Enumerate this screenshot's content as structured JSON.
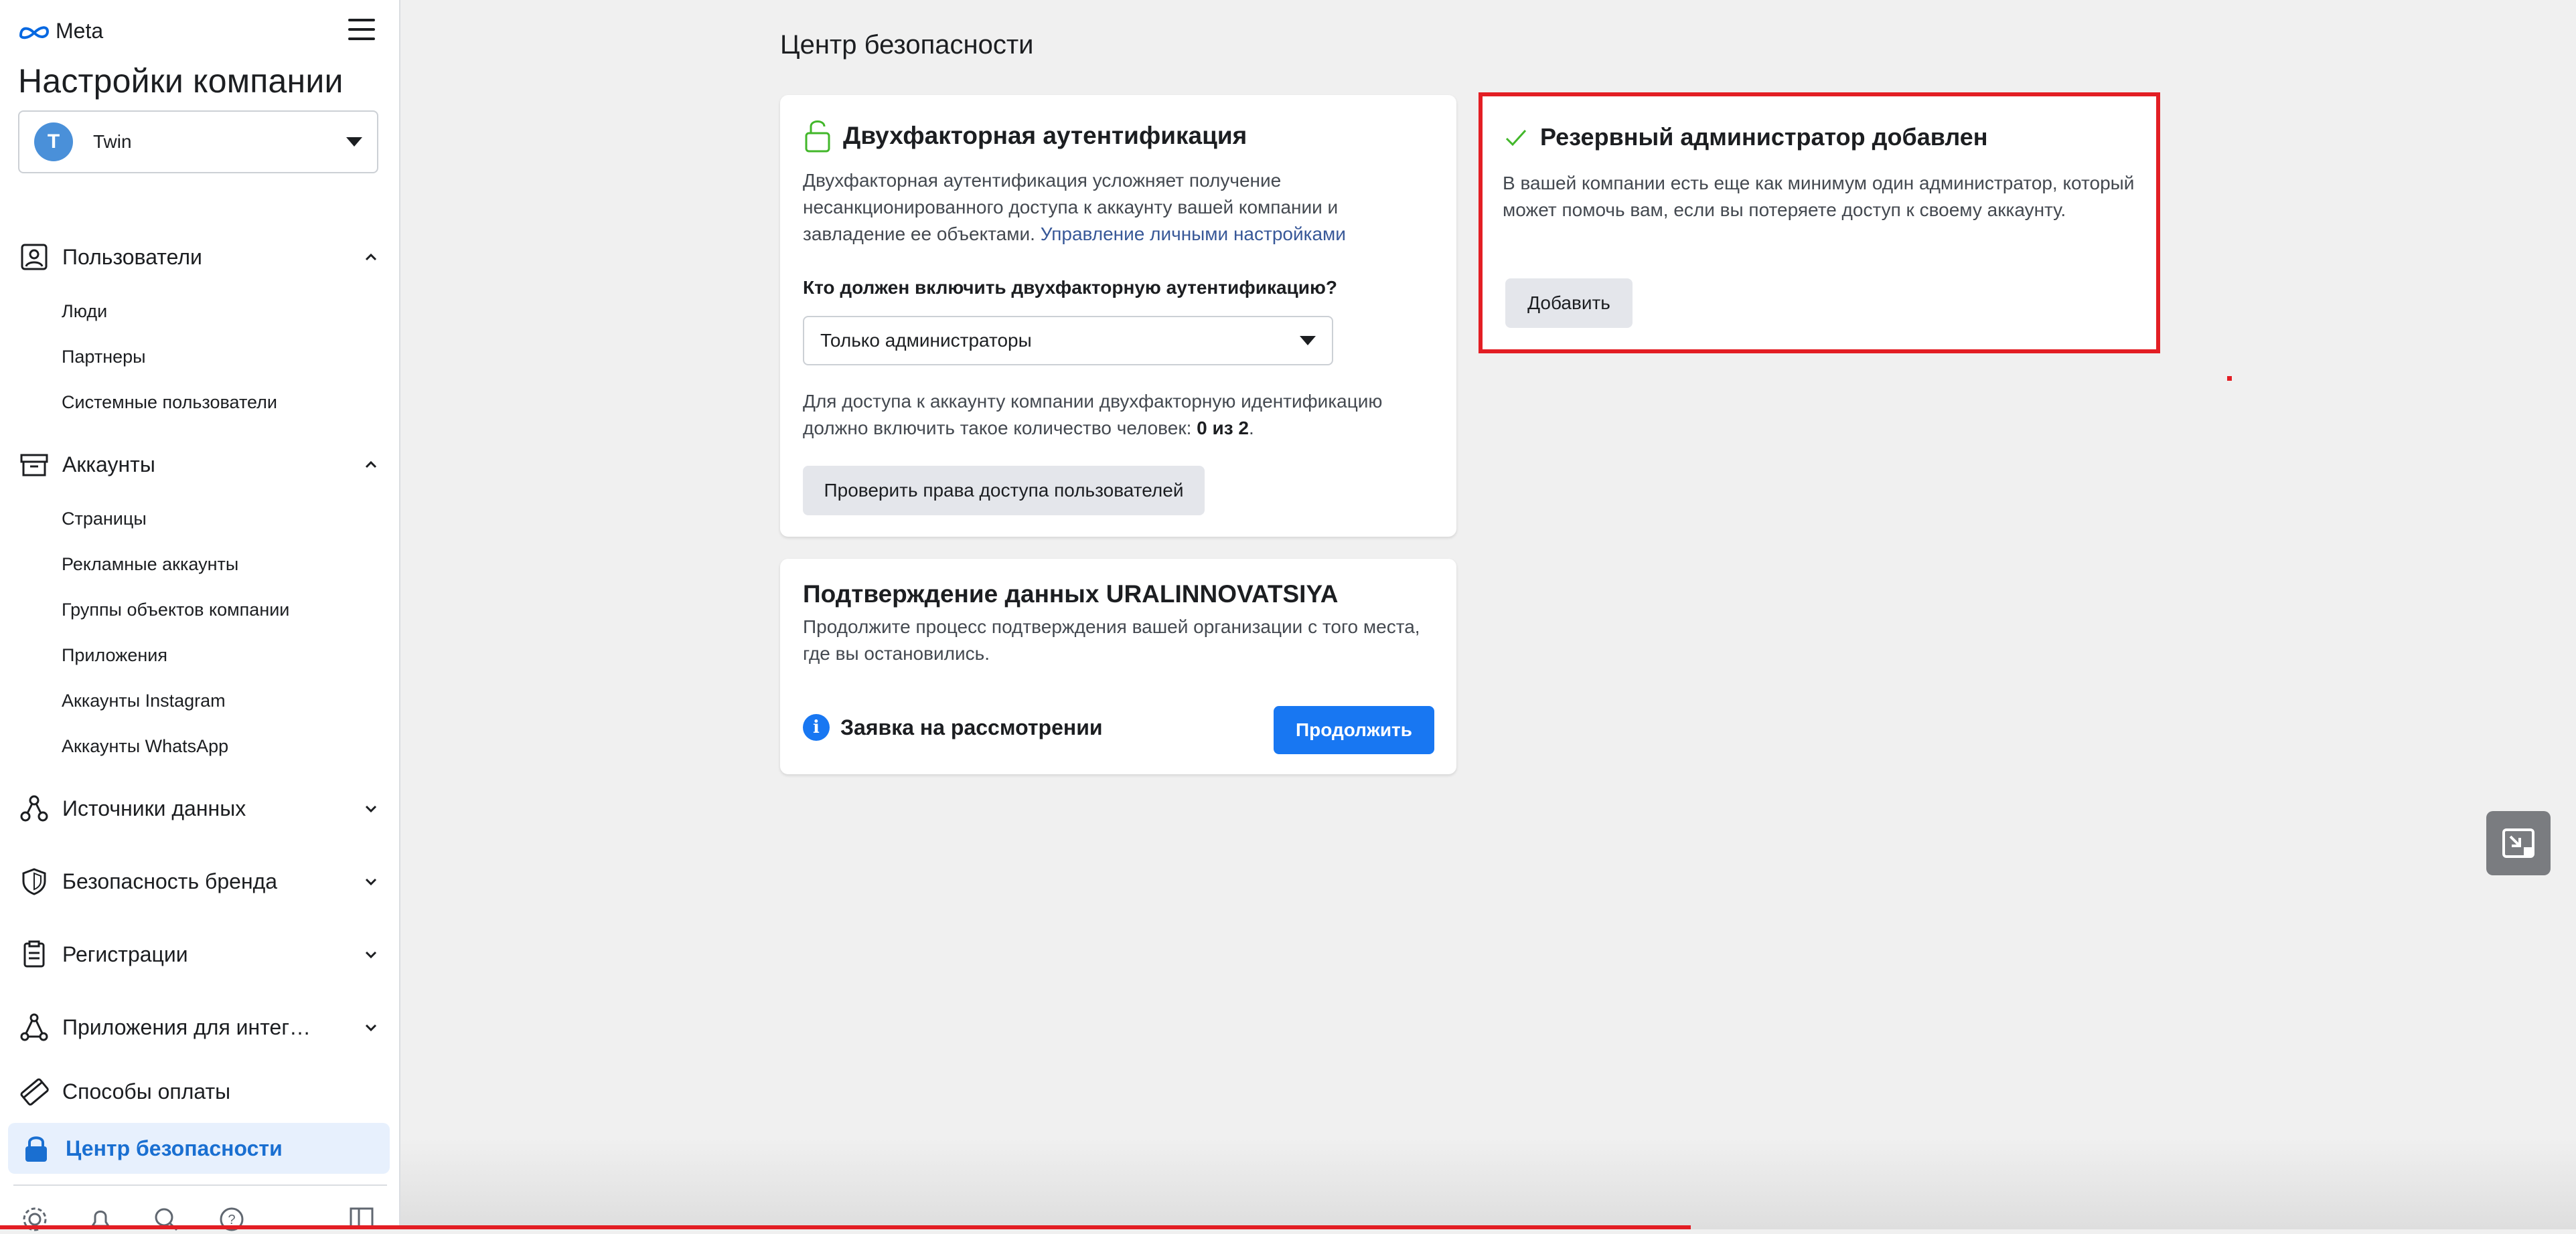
{
  "sidebar": {
    "brand": "Meta",
    "company_title": "Настройки компании",
    "account": {
      "initial": "T",
      "name": "Twin"
    },
    "sections": [
      {
        "label": "Пользователи",
        "expanded": true,
        "items": [
          "Люди",
          "Партнеры",
          "Системные пользователи"
        ]
      },
      {
        "label": "Аккаунты",
        "expanded": true,
        "items": [
          "Страницы",
          "Рекламные аккаунты",
          "Группы объектов компании",
          "Приложения",
          "Аккаунты Instagram",
          "Аккаунты WhatsApp"
        ]
      },
      {
        "label": "Источники данных",
        "expanded": false
      },
      {
        "label": "Безопасность бренда",
        "expanded": false
      },
      {
        "label": "Регистрации",
        "expanded": false
      },
      {
        "label": "Приложения для интег…",
        "expanded": false
      },
      {
        "label": "Способы оплаты"
      }
    ],
    "active_item": "Центр безопасности"
  },
  "main": {
    "title": "Центр безопасности",
    "two_factor": {
      "title": "Двухфакторная аутентификация",
      "description": "Двухфакторная аутентификация усложняет получение несанкционированного доступа к аккаунту вашей компании и завладение ее объектами.",
      "link": "Управление личными настройками",
      "question": "Кто должен включить двухфакторную аутентификацию?",
      "selected_option": "Только администраторы",
      "count_text": "Для доступа к аккаунту компании двухфакторную идентификацию должно включить такое количество человек:",
      "count_value": "0 из 2",
      "check_button": "Проверить права доступа пользователей"
    },
    "verification": {
      "title": "Подтверждение данных URALINNOVATSIYA",
      "description": "Продолжите процесс подтверждения вашей организации с того места, где вы остановились.",
      "status": "Заявка на рассмотрении",
      "continue_button": "Продолжить"
    },
    "backup_admin": {
      "title": "Резервный администратор добавлен",
      "description": "В вашей компании есть еще как минимум один администратор, который может помочь вам, если вы потеряете доступ к своему аккаунту.",
      "add_button": "Добавить"
    }
  },
  "colors": {
    "accent": "#1877f2",
    "highlight": "#e31e24",
    "active_bg": "#e7f0fd"
  }
}
